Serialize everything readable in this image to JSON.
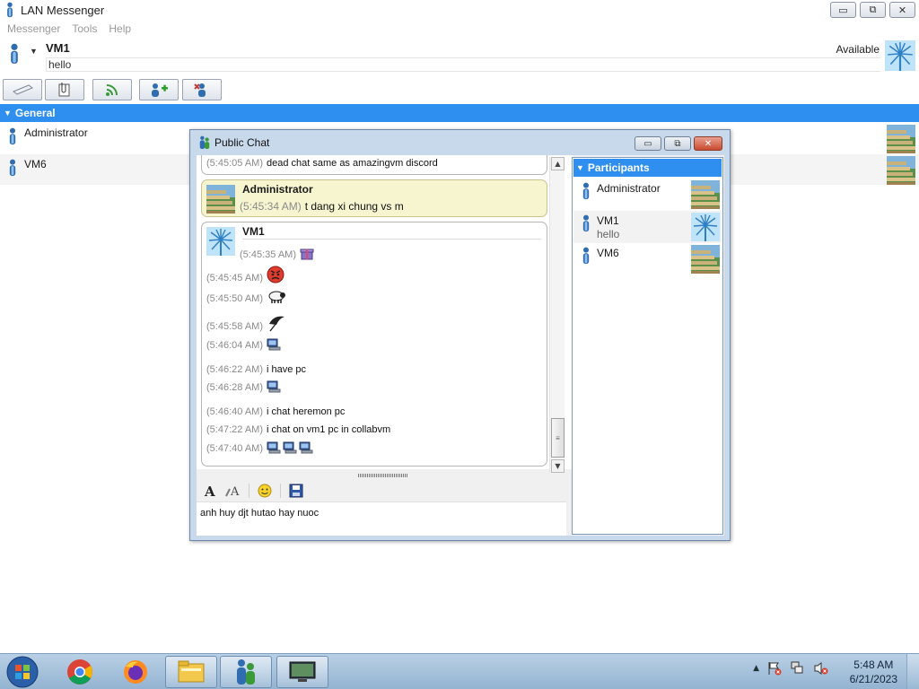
{
  "window": {
    "title": "LAN Messenger",
    "buttons": {
      "minimize": "▭",
      "maximize": "⧉",
      "close": "✕"
    }
  },
  "menu": [
    "Messenger",
    "Tools",
    "Help"
  ],
  "header": {
    "user_name": "VM1",
    "status_message": "hello",
    "availability": "Available"
  },
  "toolbar": {
    "icons": [
      "chat-icon",
      "file-transfer-icon",
      "broadcast-icon",
      "add-contact-icon",
      "remove-contact-icon"
    ]
  },
  "group": {
    "name": "General"
  },
  "contacts": [
    {
      "name": "Administrator"
    },
    {
      "name": "VM6"
    }
  ],
  "chat": {
    "title": "Public Chat",
    "messages": {
      "m0": {
        "time": "(5:45:05 AM)",
        "text": "dead chat same as amazingvm discord"
      },
      "admin": {
        "sender": "Administrator",
        "time": "(5:45:34 AM)",
        "text": "t dang xi chung vs m"
      },
      "vm1": {
        "sender": "VM1",
        "lines": [
          {
            "time": "(5:45:35 AM)",
            "text": "",
            "icons": [
              "gift-icon"
            ]
          },
          {
            "time": "(5:45:45 AM)",
            "text": "",
            "icons": [
              "angry-face-icon"
            ]
          },
          {
            "time": "(5:45:50 AM)",
            "text": "",
            "icons": [
              "sheep-icon"
            ]
          },
          {
            "time": "(5:45:58 AM)",
            "text": "",
            "icons": [
              "umbrella-icon"
            ]
          },
          {
            "time": "(5:46:04 AM)",
            "text": "",
            "icons": [
              "computer-icon"
            ]
          },
          {
            "time": "(5:46:22 AM)",
            "text": "i have pc",
            "icons": []
          },
          {
            "time": "(5:46:28 AM)",
            "text": "",
            "icons": [
              "computer-icon"
            ]
          },
          {
            "time": "(5:46:40 AM)",
            "text": "i chat heremon pc",
            "icons": []
          },
          {
            "time": "(5:47:22 AM)",
            "text": "i chat  on vm1 pc in collabvm",
            "icons": []
          },
          {
            "time": "(5:47:40 AM)",
            "text": "",
            "icons": [
              "computer-icon",
              "computer-icon",
              "computer-icon"
            ]
          }
        ]
      }
    },
    "input_text": "anh huy djt hutao  hay nuoc",
    "participants_title": "Participants",
    "participants": [
      {
        "name": "Administrator",
        "note": ""
      },
      {
        "name": "VM1",
        "note": "hello"
      },
      {
        "name": "VM6",
        "note": ""
      }
    ]
  },
  "taskbar": {
    "apps": [
      "start-orb",
      "chrome-icon",
      "firefox-icon",
      "file-explorer-icon",
      "lan-messenger-icon",
      "computer-monitor-icon"
    ],
    "clock_time": "5:48 AM",
    "clock_date": "6/21/2023"
  },
  "colors": {
    "accent": "#2e8ff0",
    "admin_bubble": "#f6f5d0"
  }
}
